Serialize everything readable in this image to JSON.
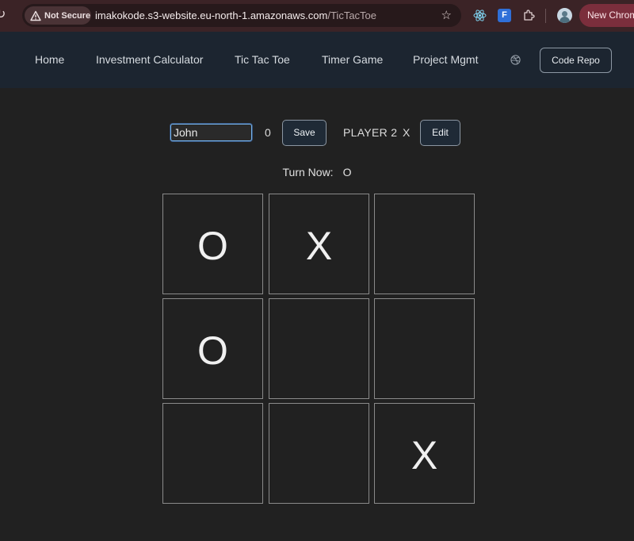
{
  "browser": {
    "security_label": "Not Secure",
    "url_host": "imakokode.s3-website.eu-north-1.amazonaws.com",
    "url_path": "/TicTacToe",
    "extension_f_label": "F",
    "new_chrome_label": "New Chrom"
  },
  "nav": {
    "items": [
      {
        "label": "Home"
      },
      {
        "label": "Investment Calculator"
      },
      {
        "label": "Tic Tac Toe"
      },
      {
        "label": "Timer Game"
      },
      {
        "label": "Project Mgmt"
      }
    ],
    "repo_button": "Code Repo"
  },
  "players": {
    "p1": {
      "name_value": "John",
      "symbol": "0",
      "button": "Save"
    },
    "p2": {
      "name": "PLAYER 2",
      "symbol": "X",
      "button": "Edit"
    }
  },
  "turn": {
    "label": "Turn Now:",
    "value": "O"
  },
  "board": {
    "cells": [
      "O",
      "X",
      "",
      "O",
      "",
      "",
      "",
      "",
      "X"
    ]
  },
  "colors": {
    "nav_bg": "#1c2530",
    "page_bg": "#212121",
    "input_focus": "#77b6ef"
  }
}
